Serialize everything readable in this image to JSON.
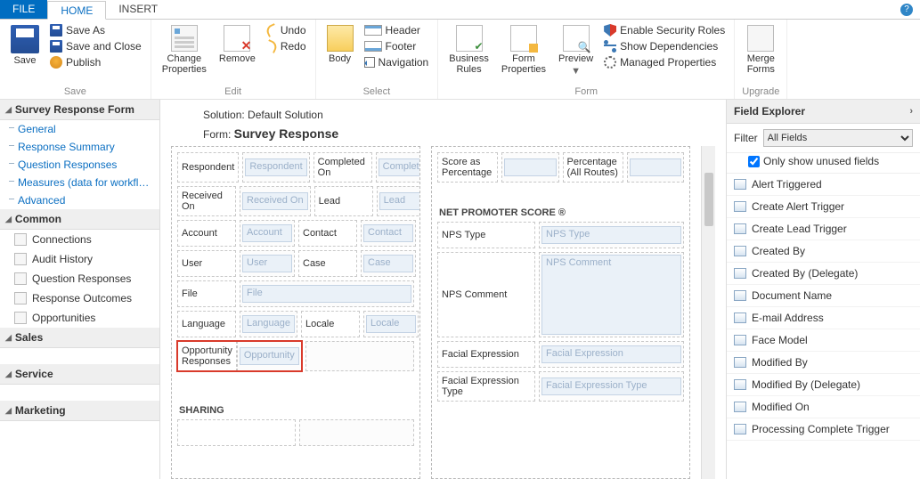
{
  "tabs": {
    "file": "FILE",
    "home": "HOME",
    "insert": "INSERT"
  },
  "ribbon": {
    "save": {
      "save": "Save",
      "save_as": "Save As",
      "save_close": "Save and Close",
      "publish": "Publish",
      "group": "Save"
    },
    "edit": {
      "change_props": "Change\nProperties",
      "remove": "Remove",
      "undo": "Undo",
      "redo": "Redo",
      "group": "Edit"
    },
    "select": {
      "body": "Body",
      "header": "Header",
      "footer": "Footer",
      "navigation": "Navigation",
      "group": "Select"
    },
    "form": {
      "rules": "Business\nRules",
      "props": "Form\nProperties",
      "preview": "Preview",
      "security": "Enable Security Roles",
      "deps": "Show Dependencies",
      "managed": "Managed Properties",
      "group": "Form"
    },
    "upgrade": {
      "merge": "Merge\nForms",
      "group": "Upgrade"
    }
  },
  "left": {
    "title": "Survey Response Form",
    "items": [
      "General",
      "Response Summary",
      "Question Responses",
      "Measures (data for workflo…",
      "Advanced"
    ],
    "common": {
      "title": "Common",
      "items": [
        "Connections",
        "Audit History",
        "Question Responses",
        "Response Outcomes",
        "Opportunities"
      ]
    },
    "sales": "Sales",
    "service": "Service",
    "marketing": "Marketing"
  },
  "canvas": {
    "solution_prefix": "Solution: ",
    "solution": "Default Solution",
    "form_prefix": "Form: ",
    "form": "Survey Response",
    "col1": [
      [
        "Respondent",
        "Respondent",
        "Completed On",
        "Completed"
      ],
      [
        "Received On",
        "Received On",
        "Lead",
        "Lead"
      ],
      [
        "Account",
        "Account",
        "Contact",
        "Contact"
      ],
      [
        "User",
        "User",
        "Case",
        "Case"
      ],
      [
        "File",
        "",
        "",
        "File"
      ],
      [
        "Language",
        "Language",
        "Locale",
        "Locale"
      ],
      [
        "Opportunity Responses",
        "Opportunity",
        "",
        ""
      ]
    ],
    "sharing": "SHARING",
    "col2_top": [
      "Score as Percentage",
      "",
      "Percentage (All Routes)",
      ""
    ],
    "nps_title": "NET PROMOTER SCORE ®",
    "nps": [
      [
        "NPS Type",
        "NPS Type"
      ],
      [
        "NPS Comment",
        "NPS Comment"
      ],
      [
        "Facial Expression",
        "Facial Expression"
      ],
      [
        "Facial Expression Type",
        "Facial Expression Type"
      ]
    ]
  },
  "right": {
    "title": "Field Explorer",
    "filter_label": "Filter",
    "filter_value": "All Fields",
    "only_unused": "Only show unused fields",
    "fields": [
      "Alert Triggered",
      "Create Alert Trigger",
      "Create Lead Trigger",
      "Created By",
      "Created By (Delegate)",
      "Document Name",
      "E-mail Address",
      "Face Model",
      "Modified By",
      "Modified By (Delegate)",
      "Modified On",
      "Processing Complete Trigger"
    ]
  }
}
